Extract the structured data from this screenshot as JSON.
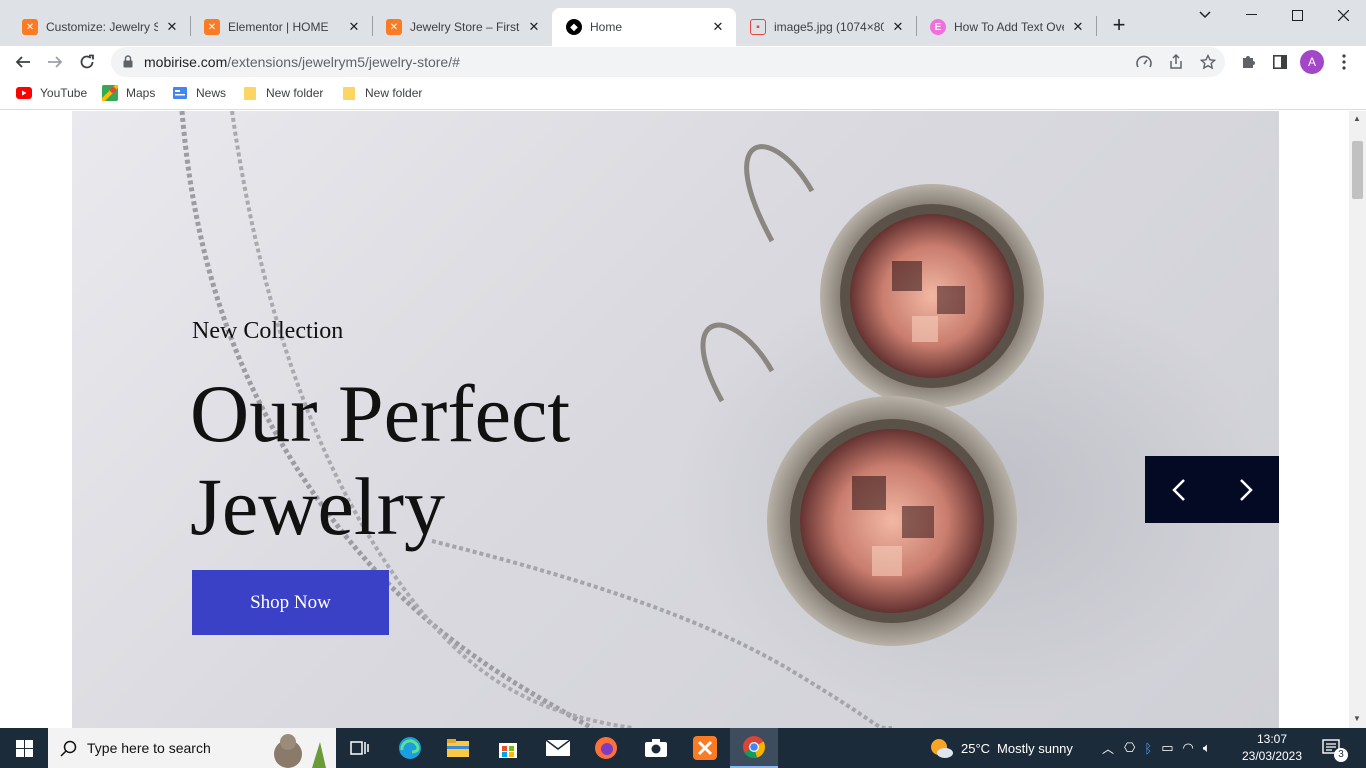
{
  "browser": {
    "tabs": [
      {
        "title": "Customize: Jewelry Sto",
        "favicon": "xampp-icon",
        "color": "#fb7a24"
      },
      {
        "title": "Elementor | HOME",
        "favicon": "xampp-icon",
        "color": "#fb7a24"
      },
      {
        "title": "Jewelry Store – First w",
        "favicon": "xampp-icon",
        "color": "#fb7a24"
      },
      {
        "title": "Home",
        "favicon": "mobirise-icon",
        "color": "#000000"
      },
      {
        "title": "image5.jpg (1074×806",
        "favicon": "image-icon",
        "color": "#e8453c"
      },
      {
        "title": "How To Add Text Over",
        "favicon": "elementor-icon",
        "color": "#f06fdc"
      }
    ],
    "url_host": "mobirise.com",
    "url_path": "/extensions/jewelrym5/jewelry-store/#",
    "profile_initial": "A",
    "bookmarks": [
      {
        "label": "YouTube",
        "icon": "youtube-icon"
      },
      {
        "label": "Maps",
        "icon": "maps-icon"
      },
      {
        "label": "News",
        "icon": "news-icon"
      },
      {
        "label": "New folder",
        "icon": "folder-icon"
      },
      {
        "label": "New folder",
        "icon": "folder-icon"
      }
    ]
  },
  "hero": {
    "subtitle": "New Collection",
    "headline": "Our Perfect Jewelry",
    "cta_label": "Shop Now",
    "cta_color": "#3a41c6",
    "carousel_bg": "#050a24"
  },
  "taskbar": {
    "search_placeholder": "Type here to search",
    "weather_temp": "25°C",
    "weather_desc": "Mostly sunny",
    "time": "13:07",
    "date": "23/03/2023",
    "notification_count": "3"
  }
}
